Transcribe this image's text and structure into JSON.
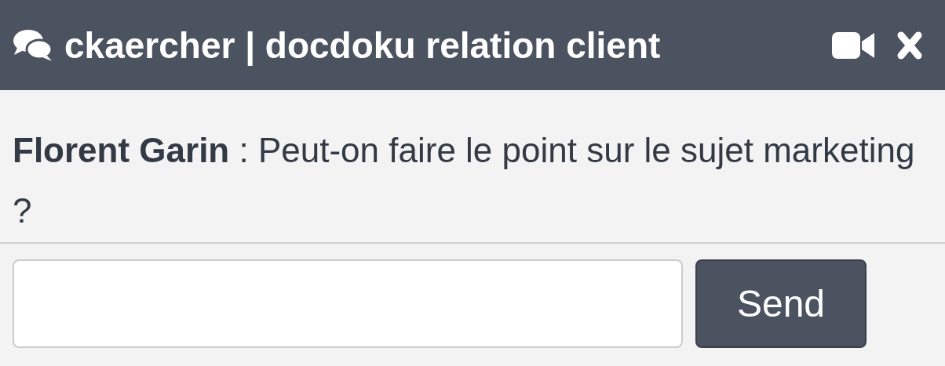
{
  "window": {
    "title": "ckaercher | docdoku relation client"
  },
  "messages": [
    {
      "text": "**Florent Garin** : Peut-on faire le point sur le sujet marketing ?"
    }
  ],
  "composer": {
    "send_button": "Send"
  }
}
